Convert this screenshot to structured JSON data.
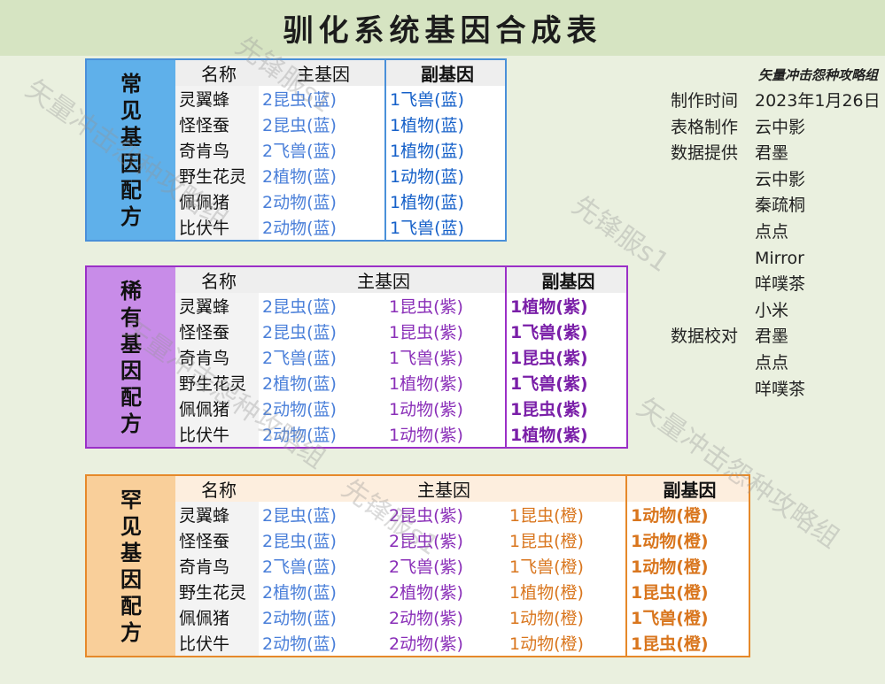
{
  "title": "驯化系统基因合成表",
  "credits": {
    "group": "矢量冲击怨种攻略组",
    "rows": [
      {
        "label": "制作时间",
        "value": "2023年1月26日"
      },
      {
        "label": "表格制作",
        "value": "云中影"
      },
      {
        "label": "数据提供",
        "value": "君墨"
      },
      {
        "label": "",
        "value": "云中影"
      },
      {
        "label": "",
        "value": "秦疏桐"
      },
      {
        "label": "",
        "value": "点点"
      },
      {
        "label": "",
        "value": "Mirror"
      },
      {
        "label": "",
        "value": "咩噗茶"
      },
      {
        "label": "",
        "value": "小米"
      },
      {
        "label": "数据校对",
        "value": "君墨"
      },
      {
        "label": "",
        "value": "点点"
      },
      {
        "label": "",
        "value": "咩噗茶"
      }
    ]
  },
  "watermarks": [
    "先锋服s1",
    "矢量冲击怨种攻略组"
  ],
  "common": {
    "side_chars": [
      "常",
      "见",
      "基",
      "因",
      "配",
      "方"
    ],
    "headers": {
      "name": "名称",
      "main": "主基因",
      "sub": "副基因"
    },
    "rows": [
      {
        "name": "灵翼蜂",
        "main": "2昆虫(蓝)",
        "sub": "1飞兽(蓝)"
      },
      {
        "name": "怪怪蚕",
        "main": "2昆虫(蓝)",
        "sub": "1植物(蓝)"
      },
      {
        "name": "奇肯鸟",
        "main": "2飞兽(蓝)",
        "sub": "1植物(蓝)"
      },
      {
        "name": "野生花灵",
        "main": "2植物(蓝)",
        "sub": "1动物(蓝)"
      },
      {
        "name": "佩佩猪",
        "main": "2动物(蓝)",
        "sub": "1植物(蓝)"
      },
      {
        "name": "比伏牛",
        "main": "2动物(蓝)",
        "sub": "1飞兽(蓝)"
      }
    ]
  },
  "rare": {
    "side_chars": [
      "稀",
      "有",
      "基",
      "因",
      "配",
      "方"
    ],
    "headers": {
      "name": "名称",
      "main": "主基因",
      "sub": "副基因"
    },
    "rows": [
      {
        "name": "灵翼蜂",
        "main1": "2昆虫(蓝)",
        "main2": "1昆虫(紫)",
        "sub": "1植物(紫)"
      },
      {
        "name": "怪怪蚕",
        "main1": "2昆虫(蓝)",
        "main2": "1昆虫(紫)",
        "sub": "1飞兽(紫)"
      },
      {
        "name": "奇肯鸟",
        "main1": "2飞兽(蓝)",
        "main2": "1飞兽(紫)",
        "sub": "1昆虫(紫)"
      },
      {
        "name": "野生花灵",
        "main1": "2植物(蓝)",
        "main2": "1植物(紫)",
        "sub": "1飞兽(紫)"
      },
      {
        "name": "佩佩猪",
        "main1": "2动物(蓝)",
        "main2": "1动物(紫)",
        "sub": "1昆虫(紫)"
      },
      {
        "name": "比伏牛",
        "main1": "2动物(蓝)",
        "main2": "1动物(紫)",
        "sub": "1植物(紫)"
      }
    ]
  },
  "rarer": {
    "side_chars": [
      "罕",
      "见",
      "基",
      "因",
      "配",
      "方"
    ],
    "headers": {
      "name": "名称",
      "main": "主基因",
      "sub": "副基因"
    },
    "rows": [
      {
        "name": "灵翼蜂",
        "main1": "2昆虫(蓝)",
        "main2": "2昆虫(紫)",
        "main3": "1昆虫(橙)",
        "sub": "1动物(橙)"
      },
      {
        "name": "怪怪蚕",
        "main1": "2昆虫(蓝)",
        "main2": "2昆虫(紫)",
        "main3": "1昆虫(橙)",
        "sub": "1动物(橙)"
      },
      {
        "name": "奇肯鸟",
        "main1": "2飞兽(蓝)",
        "main2": "2飞兽(紫)",
        "main3": "1飞兽(橙)",
        "sub": "1动物(橙)"
      },
      {
        "name": "野生花灵",
        "main1": "2植物(蓝)",
        "main2": "2植物(紫)",
        "main3": "1植物(橙)",
        "sub": "1昆虫(橙)"
      },
      {
        "name": "佩佩猪",
        "main1": "2动物(蓝)",
        "main2": "2动物(紫)",
        "main3": "1动物(橙)",
        "sub": "1飞兽(橙)"
      },
      {
        "name": "比伏牛",
        "main1": "2动物(蓝)",
        "main2": "2动物(紫)",
        "main3": "1动物(橙)",
        "sub": "1昆虫(橙)"
      }
    ]
  },
  "colors": {
    "common_border": "#4a90d9",
    "rare_border": "#9b30c7",
    "rarer_border": "#e6892a",
    "blue_text": "#4a7fd9",
    "purple_text": "#8a2fb8",
    "orange_text": "#d9761e"
  }
}
